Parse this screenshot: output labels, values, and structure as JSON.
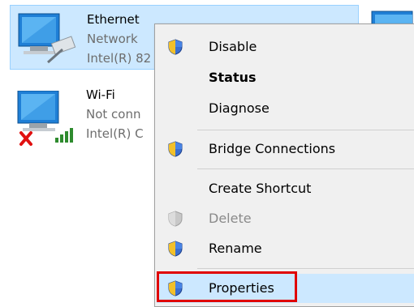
{
  "adapters": [
    {
      "name": "Ethernet",
      "status": "Network",
      "device": "Intel(R) 82"
    },
    {
      "name": "Wi-Fi",
      "status": "Not conn",
      "device": "Intel(R) C"
    }
  ],
  "context_menu": {
    "items": [
      {
        "label": "Disable",
        "icon": "uac-shield-icon"
      },
      {
        "label": "Status",
        "icon": ""
      },
      {
        "label": "Diagnose",
        "icon": ""
      },
      {
        "label": "Bridge Connections",
        "icon": "uac-shield-icon"
      },
      {
        "label": "Create Shortcut",
        "icon": ""
      },
      {
        "label": "Delete",
        "icon": "uac-shield-icon"
      },
      {
        "label": "Rename",
        "icon": "uac-shield-icon"
      },
      {
        "label": "Properties",
        "icon": "uac-shield-icon"
      }
    ]
  },
  "colors": {
    "selection": "#cce8ff",
    "highlight_border": "#e00000"
  }
}
